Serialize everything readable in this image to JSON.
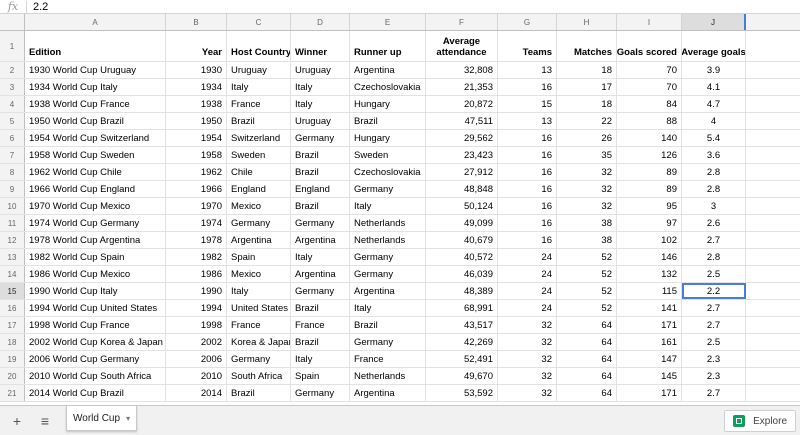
{
  "formula_bar": {
    "icon_label": "fx",
    "value": "2.2"
  },
  "columns": [
    "A",
    "B",
    "C",
    "D",
    "E",
    "F",
    "G",
    "H",
    "I",
    "J"
  ],
  "selected_column": "J",
  "selected_row": "15",
  "headers": {
    "row_number": "1",
    "cells": [
      "Edition",
      "Year",
      "Host Country",
      "Winner",
      "Runner up",
      "Average attendance",
      "Teams",
      "Matches",
      "Goals scored",
      "Average goals"
    ]
  },
  "rows": [
    {
      "n": "2",
      "c": [
        "1930 World Cup Uruguay",
        "1930",
        "Uruguay",
        "Uruguay",
        "Argentina",
        "32,808",
        "13",
        "18",
        "70",
        "3.9"
      ]
    },
    {
      "n": "3",
      "c": [
        "1934 World Cup Italy",
        "1934",
        "Italy",
        "Italy",
        "Czechoslovakia",
        "21,353",
        "16",
        "17",
        "70",
        "4.1"
      ]
    },
    {
      "n": "4",
      "c": [
        "1938 World Cup France",
        "1938",
        "France",
        "Italy",
        "Hungary",
        "20,872",
        "15",
        "18",
        "84",
        "4.7"
      ]
    },
    {
      "n": "5",
      "c": [
        "1950 World Cup Brazil",
        "1950",
        "Brazil",
        "Uruguay",
        "Brazil",
        "47,511",
        "13",
        "22",
        "88",
        "4"
      ]
    },
    {
      "n": "6",
      "c": [
        "1954 World Cup Switzerland",
        "1954",
        "Switzerland",
        "Germany",
        "Hungary",
        "29,562",
        "16",
        "26",
        "140",
        "5.4"
      ]
    },
    {
      "n": "7",
      "c": [
        "1958 World Cup Sweden",
        "1958",
        "Sweden",
        "Brazil",
        "Sweden",
        "23,423",
        "16",
        "35",
        "126",
        "3.6"
      ]
    },
    {
      "n": "8",
      "c": [
        "1962 World Cup Chile",
        "1962",
        "Chile",
        "Brazil",
        "Czechoslovakia",
        "27,912",
        "16",
        "32",
        "89",
        "2.8"
      ]
    },
    {
      "n": "9",
      "c": [
        "1966 World Cup England",
        "1966",
        "England",
        "England",
        "Germany",
        "48,848",
        "16",
        "32",
        "89",
        "2.8"
      ]
    },
    {
      "n": "10",
      "c": [
        "1970 World Cup Mexico",
        "1970",
        "Mexico",
        "Brazil",
        "Italy",
        "50,124",
        "16",
        "32",
        "95",
        "3"
      ]
    },
    {
      "n": "11",
      "c": [
        "1974 World Cup Germany",
        "1974",
        "Germany",
        "Germany",
        "Netherlands",
        "49,099",
        "16",
        "38",
        "97",
        "2.6"
      ]
    },
    {
      "n": "12",
      "c": [
        "1978 World Cup Argentina",
        "1978",
        "Argentina",
        "Argentina",
        "Netherlands",
        "40,679",
        "16",
        "38",
        "102",
        "2.7"
      ]
    },
    {
      "n": "13",
      "c": [
        "1982 World Cup Spain",
        "1982",
        "Spain",
        "Italy",
        "Germany",
        "40,572",
        "24",
        "52",
        "146",
        "2.8"
      ]
    },
    {
      "n": "14",
      "c": [
        "1986 World Cup Mexico",
        "1986",
        "Mexico",
        "Argentina",
        "Germany",
        "46,039",
        "24",
        "52",
        "132",
        "2.5"
      ]
    },
    {
      "n": "15",
      "c": [
        "1990 World Cup Italy",
        "1990",
        "Italy",
        "Germany",
        "Argentina",
        "48,389",
        "24",
        "52",
        "115",
        "2.2"
      ]
    },
    {
      "n": "16",
      "c": [
        "1994 World Cup United States",
        "1994",
        "United States",
        "Brazil",
        "Italy",
        "68,991",
        "24",
        "52",
        "141",
        "2.7"
      ]
    },
    {
      "n": "17",
      "c": [
        "1998 World Cup France",
        "1998",
        "France",
        "France",
        "Brazil",
        "43,517",
        "32",
        "64",
        "171",
        "2.7"
      ]
    },
    {
      "n": "18",
      "c": [
        "2002 World Cup Korea & Japan",
        "2002",
        "Korea & Japan",
        "Brazil",
        "Germany",
        "42,269",
        "32",
        "64",
        "161",
        "2.5"
      ]
    },
    {
      "n": "19",
      "c": [
        "2006 World Cup Germany",
        "2006",
        "Germany",
        "Italy",
        "France",
        "52,491",
        "32",
        "64",
        "147",
        "2.3"
      ]
    },
    {
      "n": "20",
      "c": [
        "2010 World Cup South Africa",
        "2010",
        "South Africa",
        "Spain",
        "Netherlands",
        "49,670",
        "32",
        "64",
        "145",
        "2.3"
      ]
    },
    {
      "n": "21",
      "c": [
        "2014 World Cup Brazil",
        "2014",
        "Brazil",
        "Germany",
        "Argentina",
        "53,592",
        "32",
        "64",
        "171",
        "2.7"
      ]
    }
  ],
  "sheet_bar": {
    "add_icon": "+",
    "list_icon": "≡",
    "tab_label": "World Cup",
    "tab_arrow": "▾",
    "explore_label": "Explore"
  },
  "colors": {
    "accent": "#4a7bd6",
    "explore_green": "#0f9d58"
  }
}
